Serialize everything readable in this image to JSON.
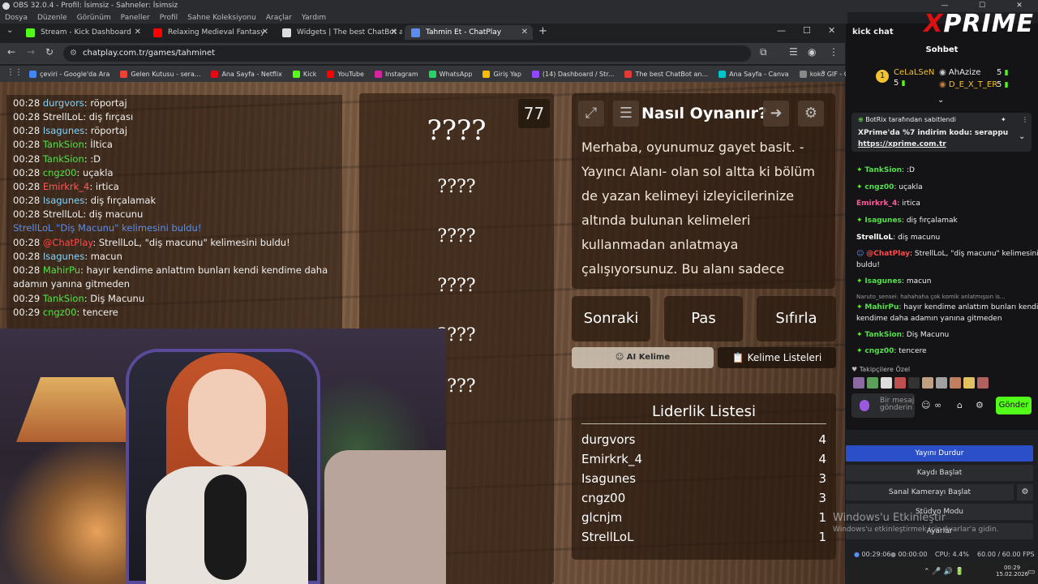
{
  "obs": {
    "title": "OBS 32.0.4 - Profil: İsimsiz - Sahneler: İsimsiz",
    "menu": [
      "Dosya",
      "Düzenle",
      "Görünüm",
      "Paneller",
      "Profil",
      "Sahne Koleksiyonu",
      "Araçlar",
      "Yardım"
    ],
    "win": [
      "—",
      "☐",
      "✕"
    ]
  },
  "browser": {
    "tabs": [
      {
        "label": "Stream - Kick Dashboard",
        "color": "#53fc18"
      },
      {
        "label": "Relaxing Medieval Fantasy",
        "color": "#ff0000"
      },
      {
        "label": "Widgets | The best ChatBot and",
        "color": "#dddddd"
      },
      {
        "label": "Tahmin Et - ChatPlay",
        "color": "#5b8def"
      }
    ],
    "url": "chatplay.com.tr/games/tahminet",
    "bookmarks": [
      {
        "label": "çeviri - Google'da Ara",
        "color": "#4285f4"
      },
      {
        "label": "Gelen Kutusu - sera...",
        "color": "#ea4335"
      },
      {
        "label": "Ana Sayfa - Netflix",
        "color": "#e50914"
      },
      {
        "label": "Kick",
        "color": "#53fc18"
      },
      {
        "label": "YouTube",
        "color": "#ff0000"
      },
      {
        "label": "Instagram",
        "color": "#d6249f"
      },
      {
        "label": "WhatsApp",
        "color": "#25d366"
      },
      {
        "label": "Giriş Yap",
        "color": "#fbbc05"
      },
      {
        "label": "(14) Dashboard / Str...",
        "color": "#9146ff"
      },
      {
        "label": "The best ChatBot an...",
        "color": "#e53935"
      },
      {
        "label": "Ana Sayfa - Canva",
        "color": "#00c4cc"
      },
      {
        "label": "koko GIF - GIPHY'd...",
        "color": "#888888"
      }
    ]
  },
  "game": {
    "chat": [
      {
        "time": "00:28",
        "user": "durgvors",
        "msg": "röportaj",
        "color": "#7fd4ff"
      },
      {
        "time": "00:28",
        "user": "StrellLoL",
        "msg": "diş fırçası",
        "color": "#f0f0f0"
      },
      {
        "time": "00:28",
        "user": "Isagunes",
        "msg": "röportaj",
        "color": "#7fd4ff"
      },
      {
        "time": "00:28",
        "user": "TankSion",
        "msg": "İltica",
        "color": "#53e04a"
      },
      {
        "time": "00:28",
        "user": "TankSion",
        "msg": ":D",
        "color": "#53e04a"
      },
      {
        "time": "00:28",
        "user": "cngz00",
        "msg": "uçakla",
        "color": "#53e04a"
      },
      {
        "time": "00:28",
        "user": "Emirkrk_4",
        "msg": "irtica",
        "color": "#ff5a5a"
      },
      {
        "time": "00:28",
        "user": "Isagunes",
        "msg": "diş fırçalamak",
        "color": "#7fd4ff"
      },
      {
        "time": "00:28",
        "user": "StrellLoL",
        "msg": "diş macunu",
        "color": "#f0f0f0"
      }
    ],
    "found_notice": "StrellLoL \"Diş Macunu\" kelimesini buldu!",
    "chat2": [
      {
        "time": "00:28",
        "user": "@ChatPlay",
        "msg": "StrellLoL, \"diş macunu\" kelimesini buldu!",
        "color": "#ff4a4a"
      },
      {
        "time": "00:28",
        "user": "Isagunes",
        "msg": "macun",
        "color": "#7fd4ff"
      },
      {
        "time": "00:28",
        "user": "MahirPu",
        "msg": "hayır kendime anlattım bunları kendi kendime daha",
        "color": "#53e04a"
      }
    ],
    "chat2_cont": "adamın yanına gitmeden",
    "chat3": [
      {
        "time": "00:29",
        "user": "TankSion",
        "msg": "Diş Macunu",
        "color": "#53e04a"
      },
      {
        "time": "00:29",
        "user": "cngz00",
        "msg": "tencere",
        "color": "#53e04a"
      }
    ],
    "words": [
      "????",
      "????",
      "????",
      "????",
      "????",
      "????"
    ],
    "timer": "77",
    "howto_title": "Nasıl Oynanır?",
    "howto_text": "Merhaba, oyunumuz gayet basit. -Yayıncı Alanı- olan sol altta ki bölüm de yazan kelimeyi izleyicilerinize altında bulunan kelimeleri kullanmadan anlatmaya çalışıyorsunuz. Bu alanı sadece",
    "buttons": {
      "next": "Sonraki",
      "pass": "Pas",
      "reset": "Sıfırla",
      "ai": "AI Kelime",
      "lists": "Kelime Listeleri"
    },
    "leaderboard_title": "Liderlik Listesi",
    "leaderboard": [
      {
        "name": "durgvors",
        "score": "4"
      },
      {
        "name": "Emirkrk_4",
        "score": "4"
      },
      {
        "name": "Isagunes",
        "score": "3"
      },
      {
        "name": "cngz00",
        "score": "3"
      },
      {
        "name": "glcnjm",
        "score": "1"
      },
      {
        "name": "StrellLoL",
        "score": "1"
      }
    ]
  },
  "kick": {
    "header": "kick chat",
    "brand": "PRIME",
    "brand_x": "X",
    "tab": "Sohbet",
    "top_users": [
      {
        "name": "CeLaLSeN",
        "count": "5"
      },
      {
        "name": "AhAzize",
        "count": "5"
      },
      {
        "name": "D_E_X_T_ER",
        "count": "5"
      }
    ],
    "pinned_by": "BotRix tarafından sabitlendi",
    "pinned_msg": "XPrime'da %7 indirim kodu: serappu",
    "pinned_link": "https://xprime.com.tr",
    "messages": [
      {
        "user": "TankSion",
        "msg": ":D",
        "color": "#53e04a"
      },
      {
        "user": "cngz00",
        "msg": "uçakla",
        "color": "#53e04a"
      },
      {
        "user": "Emirkrk_4",
        "msg": "irtica",
        "color": "#ff5a9a"
      },
      {
        "user": "Isagunes",
        "msg": "diş fırçalamak",
        "color": "#53e04a"
      },
      {
        "user": "StrellLoL",
        "msg": "diş macunu",
        "color": "#ffffff"
      },
      {
        "user": "@ChatPlay",
        "msg": "StrellLoL, \"diş macunu\" kelimesini",
        "color": "#ff4a4a"
      }
    ],
    "msg_cont": "buldu!",
    "messages2": [
      {
        "user": "Isagunes",
        "msg": "macun",
        "color": "#53e04a"
      }
    ],
    "reply": "Naruto_sensei: hahahaha çok komik anlatmışsın is...",
    "messages3": [
      {
        "user": "MahirPu",
        "msg": "hayır kendime anlattım bunları kendi",
        "color": "#53e04a"
      }
    ],
    "msg3_cont": "kendime daha adamın yanına gitmeden",
    "messages4": [
      {
        "user": "TankSion",
        "msg": "Diş Macunu",
        "color": "#53e04a"
      },
      {
        "user": "cngz00",
        "msg": "tencere",
        "color": "#53e04a"
      }
    ],
    "follower": "Takipçilere Özel",
    "input_placeholder": "Bir mesaj gönderin",
    "send": "Gönder"
  },
  "obs_controls": [
    "Yayını Durdur",
    "Kaydı Başlat",
    "Sanal Kamerayı Başlat",
    "Stüdyo Modu",
    "Ayarlar"
  ],
  "windows_activate": "Windows'u Etkinleştir",
  "windows_activate_sub": "Windows'u etkinleştirmek için Ayarlar'a gidin.",
  "status": {
    "live": "00:29:06",
    "rec": "00:00:00",
    "cpu": "CPU: 4.4%",
    "fps": "60.00 / 60.00 FPS"
  },
  "clock": {
    "time": "00:29",
    "date": "15.02.2026"
  }
}
